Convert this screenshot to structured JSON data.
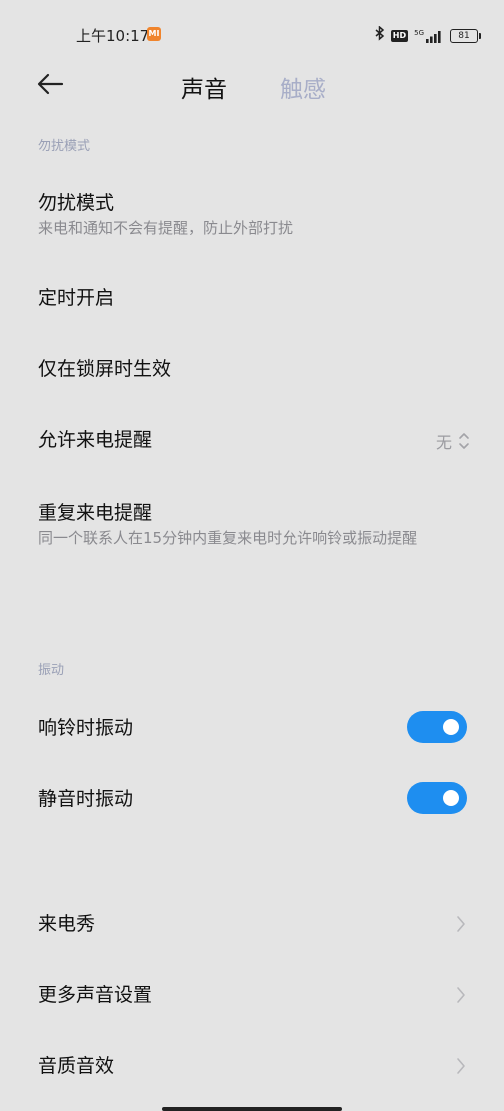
{
  "status_bar": {
    "time": "上午10:17",
    "mi_badge": "MI",
    "hd": "HD",
    "network": "5G",
    "battery": "81"
  },
  "header": {
    "tabs": [
      {
        "label": "声音",
        "active": true
      },
      {
        "label": "触感",
        "active": false
      }
    ]
  },
  "dnd_section": {
    "label": "勿扰模式",
    "items": [
      {
        "title": "勿扰模式",
        "subtitle": "来电和通知不会有提醒，防止外部打扰"
      },
      {
        "title": "定时开启"
      },
      {
        "title": "仅在锁屏时生效"
      },
      {
        "title": "允许来电提醒",
        "value": "无"
      },
      {
        "title": "重复来电提醒",
        "subtitle": "同一个联系人在15分钟内重复来电时允许响铃或振动提醒"
      }
    ]
  },
  "vibration_section": {
    "label": "振动",
    "items": [
      {
        "title": "响铃时振动",
        "enabled": true
      },
      {
        "title": "静音时振动",
        "enabled": true
      }
    ]
  },
  "more_section": {
    "items": [
      {
        "title": "来电秀"
      },
      {
        "title": "更多声音设置"
      },
      {
        "title": "音质音效"
      }
    ]
  },
  "colors": {
    "background": "#e4e4e4",
    "accent": "#1e8ef0",
    "secondary_text": "#8a8a8f",
    "section_label": "#9aa0b6"
  }
}
